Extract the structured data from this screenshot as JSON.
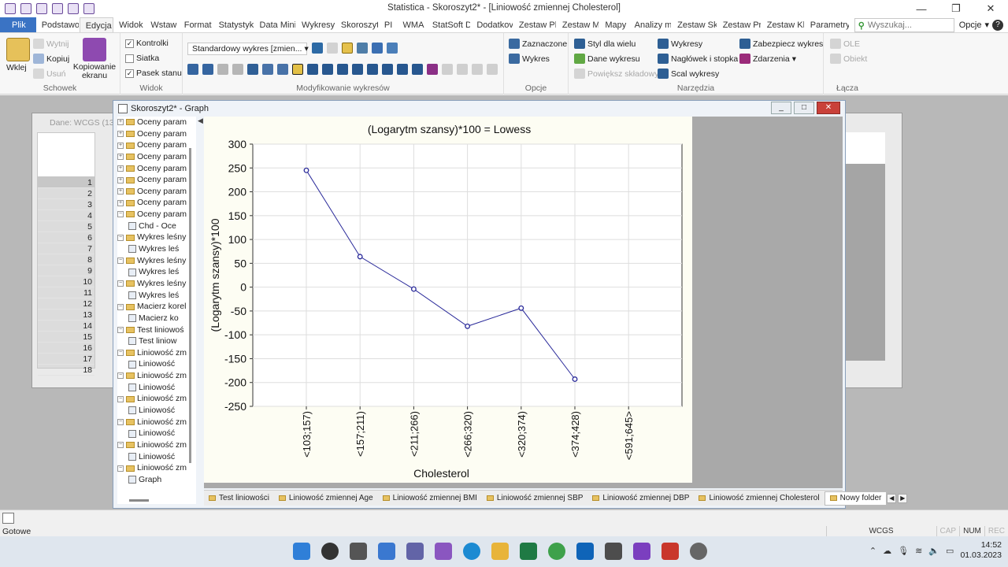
{
  "app": {
    "title": "Statistica - Skoroszyt2* - [Liniowość zmiennej Cholesterol]",
    "window_controls": [
      "minimize-icon",
      "restore-icon",
      "close-icon"
    ]
  },
  "tabs": [
    "Plik",
    "Podstawo",
    "Edycja",
    "Widok",
    "Wstaw",
    "Format",
    "Statystyk",
    "Data Mini",
    "Wykresy",
    "Skoroszyt",
    "PI",
    "WMA",
    "StatSoft D",
    "Dodatkov",
    "Zestaw Pl",
    "Zestaw M",
    "Mapy",
    "Analizy m",
    "Zestaw Sk",
    "Zestaw Pr",
    "Zestaw Kl",
    "Parametry"
  ],
  "search_placeholder": "Wyszukaj...",
  "options_label": "Opcje",
  "ribbon": {
    "schowek": {
      "label": "Schowek",
      "paste": "Wklej",
      "cut": "Wytnij",
      "copy": "Kopiuj",
      "delete": "Usuń",
      "screen_copy": "Kopiowanie ekranu"
    },
    "widok": {
      "label": "Widok",
      "controls": "Kontrolki",
      "grid": "Siatka",
      "statusbar": "Pasek stanu"
    },
    "modify": {
      "label": "Modyfikowanie wykresów",
      "template": "Standardowy wykres [zmien..."
    },
    "opcje": {
      "label": "Opcje",
      "selected": "Zaznaczone",
      "charts": "Wykres"
    },
    "narzedzia": {
      "label": "Narzędzia",
      "multi_style": "Styl dla wielu",
      "chart_data": "Dane wykresu",
      "enlarge": "Powiększ składowy",
      "charts": "Wykresy",
      "header_footer": "Nagłówek i stopka",
      "merge": "Scal wykresy",
      "protect": "Zabezpiecz wykres",
      "events": "Zdarzenia"
    },
    "lacza": {
      "label": "Łącza",
      "ole": "OLE",
      "object": "Obiekt"
    }
  },
  "data_window": {
    "title": "Dane: WCGS (13 z",
    "rows": [
      "1",
      "2",
      "3",
      "4",
      "5",
      "6",
      "7",
      "8",
      "9",
      "10",
      "11",
      "12",
      "13",
      "14",
      "15",
      "16",
      "17",
      "18"
    ]
  },
  "graph_window": {
    "title": "Skoroszyt2* - Graph",
    "tree": [
      {
        "label": "Oceny param",
        "level": 0,
        "type": "folder",
        "pm": "+"
      },
      {
        "label": "Oceny param",
        "level": 0,
        "type": "folder",
        "pm": "+"
      },
      {
        "label": "Oceny param",
        "level": 0,
        "type": "folder",
        "pm": "+"
      },
      {
        "label": "Oceny param",
        "level": 0,
        "type": "folder",
        "pm": "+"
      },
      {
        "label": "Oceny param",
        "level": 0,
        "type": "folder",
        "pm": "+"
      },
      {
        "label": "Oceny param",
        "level": 0,
        "type": "folder",
        "pm": "+"
      },
      {
        "label": "Oceny param",
        "level": 0,
        "type": "folder",
        "pm": "+"
      },
      {
        "label": "Oceny param",
        "level": 0,
        "type": "folder",
        "pm": "+"
      },
      {
        "label": "Oceny param",
        "level": 0,
        "type": "folder",
        "pm": "−"
      },
      {
        "label": "Chd - Oce",
        "level": 1,
        "type": "leaf"
      },
      {
        "label": "Wykres leśny",
        "level": 0,
        "type": "folder",
        "pm": "−"
      },
      {
        "label": "Wykres leś",
        "level": 1,
        "type": "leaf"
      },
      {
        "label": "Wykres leśny",
        "level": 0,
        "type": "folder",
        "pm": "−"
      },
      {
        "label": "Wykres leś",
        "level": 1,
        "type": "leaf"
      },
      {
        "label": "Wykres leśny",
        "level": 0,
        "type": "folder",
        "pm": "−"
      },
      {
        "label": "Wykres leś",
        "level": 1,
        "type": "leaf"
      },
      {
        "label": "Macierz korel",
        "level": 0,
        "type": "folder",
        "pm": "−"
      },
      {
        "label": "Macierz ko",
        "level": 1,
        "type": "leaf"
      },
      {
        "label": "Test liniowoś",
        "level": 0,
        "type": "folder",
        "pm": "−"
      },
      {
        "label": "Test liniow",
        "level": 1,
        "type": "leaf"
      },
      {
        "label": "Liniowość zm",
        "level": 0,
        "type": "folder",
        "pm": "−"
      },
      {
        "label": "Liniowość",
        "level": 1,
        "type": "leaf"
      },
      {
        "label": "Liniowość zm",
        "level": 0,
        "type": "folder",
        "pm": "−"
      },
      {
        "label": "Liniowość",
        "level": 1,
        "type": "leaf"
      },
      {
        "label": "Liniowość zm",
        "level": 0,
        "type": "folder",
        "pm": "−"
      },
      {
        "label": "Liniowość",
        "level": 1,
        "type": "leaf"
      },
      {
        "label": "Liniowość zm",
        "level": 0,
        "type": "folder",
        "pm": "−"
      },
      {
        "label": "Liniowość",
        "level": 1,
        "type": "leaf"
      },
      {
        "label": "Liniowość zm",
        "level": 0,
        "type": "folder",
        "pm": "−"
      },
      {
        "label": "Liniowość",
        "level": 1,
        "type": "leaf"
      },
      {
        "label": "Liniowość zm",
        "level": 0,
        "type": "folder",
        "pm": "−"
      },
      {
        "label": "Graph",
        "level": 1,
        "type": "leaf"
      }
    ],
    "sheet_tabs": [
      "Test liniowości",
      "Liniowość zmiennej Age",
      "Liniowość zmiennej BMI",
      "Liniowość zmiennej SBP",
      "Liniowość zmiennej DBP",
      "Liniowość zmiennej Cholesterol",
      "Nowy folder"
    ],
    "active_sheet_tab": 6
  },
  "chart_data": {
    "type": "line",
    "title": "(Logarytm szansy)*100 = Lowess",
    "xlabel": "Cholesterol",
    "ylabel": "(Logarytm szansy)*100",
    "categories": [
      "<103;157)",
      "<157;211)",
      "<211;266)",
      "<266;320)",
      "<320;374)",
      "<374;428)",
      "<591;645>"
    ],
    "series": [
      {
        "values": [
          245,
          64,
          -4,
          -82,
          -44,
          -193,
          null
        ]
      }
    ],
    "ylim": [
      -250,
      300
    ],
    "yticks": [
      300,
      250,
      200,
      150,
      100,
      50,
      0,
      -50,
      -100,
      -150,
      -200,
      -250
    ],
    "grid": true,
    "line_color": "#2a2a9a"
  },
  "status": {
    "text": "Gotowe",
    "fields": [
      "WCGS",
      "CAP",
      "NUM",
      "REC"
    ]
  },
  "taskbar": {
    "time": "14:52",
    "date": "01.03.2023"
  }
}
